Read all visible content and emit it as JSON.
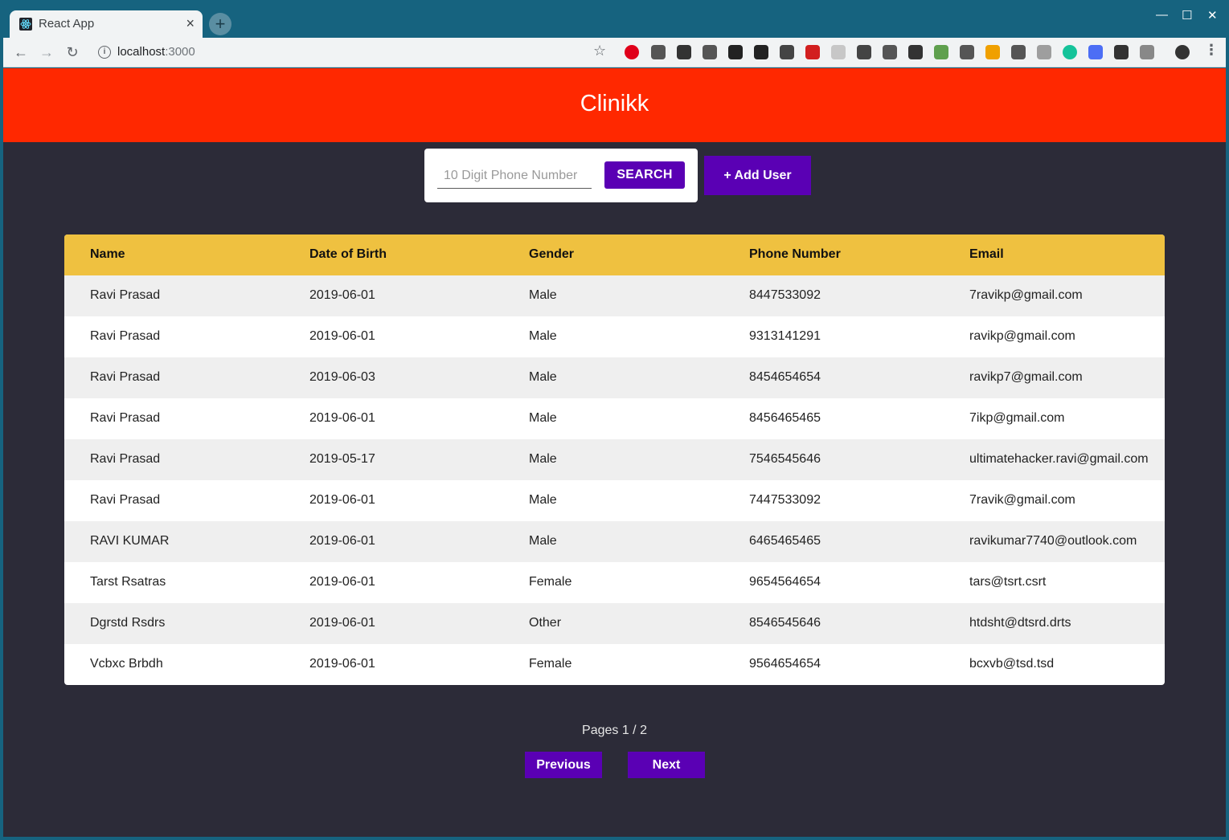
{
  "browser": {
    "tab_title": "React App",
    "url_host": "localhost",
    "url_port": ":3000",
    "extensions": [
      {
        "name": "opera-icon",
        "color": "#e0001a"
      },
      {
        "name": "eyedropper-icon",
        "color": "#555555"
      },
      {
        "name": "download-icon",
        "color": "#333333"
      },
      {
        "name": "bug-icon",
        "color": "#555555"
      },
      {
        "name": "paw-icon",
        "color": "#222222"
      },
      {
        "name": "bomb-icon",
        "color": "#222222"
      },
      {
        "name": "plane-icon",
        "color": "#444444"
      },
      {
        "name": "puzzle-red-icon",
        "color": "#d21f1f"
      },
      {
        "name": "clock-icon",
        "color": "#c7c7c7"
      },
      {
        "name": "window-icon",
        "color": "#444444"
      },
      {
        "name": "s-icon",
        "color": "#555555"
      },
      {
        "name": "screenshot-icon",
        "color": "#333333"
      },
      {
        "name": "nodejs-icon",
        "color": "#5fa04e"
      },
      {
        "name": "chrome-rings-icon",
        "color": "#555555"
      },
      {
        "name": "low-badge-icon",
        "color": "#f0a000"
      },
      {
        "name": "pocket-icon",
        "color": "#555555"
      },
      {
        "name": "tag-icon",
        "color": "#9e9e9e"
      },
      {
        "name": "grammarly-icon",
        "color": "#15c39a"
      },
      {
        "name": "translate-icon",
        "color": "#4c6ef5"
      },
      {
        "name": "s-dot-icon",
        "color": "#333333"
      },
      {
        "name": "frame-icon",
        "color": "#888888"
      },
      {
        "name": "profile-icon",
        "color": "#333333"
      }
    ]
  },
  "app": {
    "title": "Clinikk",
    "colors": {
      "header": "#ff2800",
      "accent": "#5a00b4",
      "table_head": "#efc140",
      "page_bg": "#2c2b38"
    }
  },
  "search": {
    "placeholder": "10 Digit Phone Number",
    "value": "",
    "button_label": "SEARCH"
  },
  "add_user_label": "+ Add User",
  "table": {
    "headers": [
      "Name",
      "Date of Birth",
      "Gender",
      "Phone Number",
      "Email"
    ],
    "rows": [
      [
        "Ravi Prasad",
        "2019-06-01",
        "Male",
        "8447533092",
        "7ravikp@gmail.com"
      ],
      [
        "Ravi Prasad",
        "2019-06-01",
        "Male",
        "9313141291",
        "ravikp@gmail.com"
      ],
      [
        "Ravi Prasad",
        "2019-06-03",
        "Male",
        "8454654654",
        "ravikp7@gmail.com"
      ],
      [
        "Ravi Prasad",
        "2019-06-01",
        "Male",
        "8456465465",
        "7ikp@gmail.com"
      ],
      [
        "Ravi Prasad",
        "2019-05-17",
        "Male",
        "7546545646",
        "ultimatehacker.ravi@gmail.com"
      ],
      [
        "Ravi Prasad",
        "2019-06-01",
        "Male",
        "7447533092",
        "7ravik@gmail.com"
      ],
      [
        "RAVI KUMAR",
        "2019-06-01",
        "Male",
        "6465465465",
        "ravikumar7740@outlook.com"
      ],
      [
        "Tarst Rsatras",
        "2019-06-01",
        "Female",
        "9654564654",
        "tars@tsrt.csrt"
      ],
      [
        "Dgrstd Rsdrs",
        "2019-06-01",
        "Other",
        "8546545646",
        "htdsht@dtsrd.drts"
      ],
      [
        "Vcbxc Brbdh",
        "2019-06-01",
        "Female",
        "9564654654",
        "bcxvb@tsd.tsd"
      ]
    ]
  },
  "pagination": {
    "text": "Pages 1 / 2",
    "previous_label": "Previous",
    "next_label": "Next"
  }
}
